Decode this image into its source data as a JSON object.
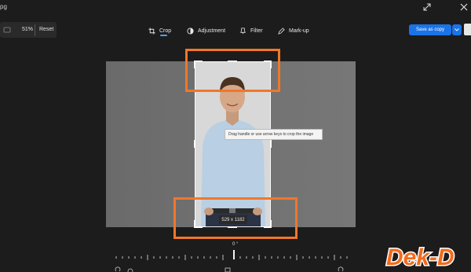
{
  "window": {
    "title_fragment": "pg"
  },
  "zoom": {
    "value": "51%",
    "reset_label": "Reset"
  },
  "toolbar": {
    "tools": [
      {
        "label": "Crop",
        "icon": "crop-icon",
        "active": true
      },
      {
        "label": "Adjustment",
        "icon": "adjustment-icon"
      },
      {
        "label": "Filter",
        "icon": "filter-icon"
      },
      {
        "label": "Mark-up",
        "icon": "markup-icon"
      }
    ],
    "save_label": "Save as copy",
    "accent_color": "#1a73e8"
  },
  "editor": {
    "tooltip": "Drag handle or use arrow keys to crop the image",
    "crop_dimensions": "529 x 1182",
    "rotation_angle": "0 °",
    "highlight_color": "#f0772a"
  },
  "watermark": {
    "text": "Dek-D"
  }
}
